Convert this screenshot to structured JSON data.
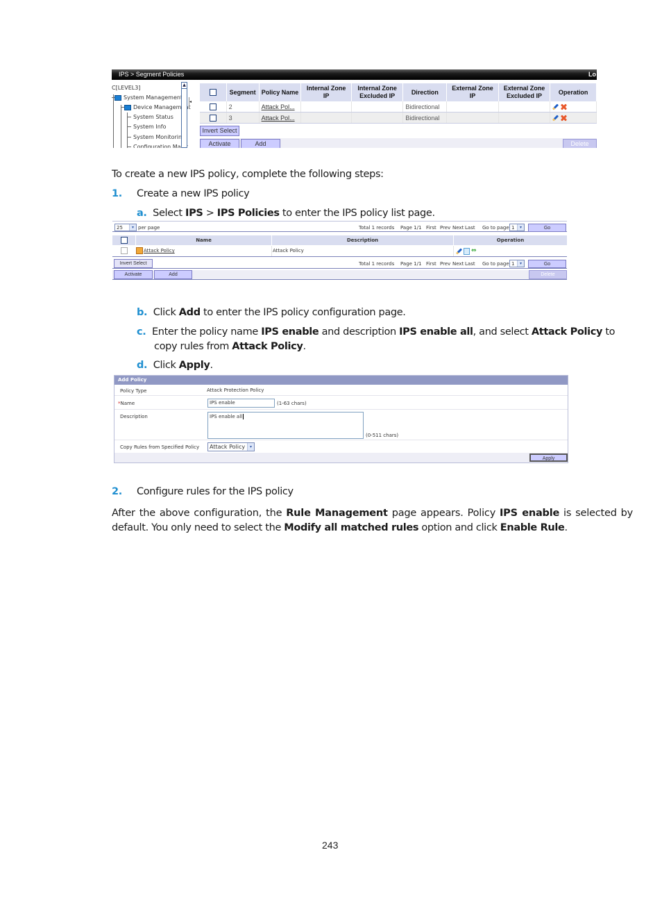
{
  "screenshot_segment_policies": {
    "breadcrumb": "IPS > Segment Policies",
    "top_right_text": "Lo",
    "tree": {
      "root": "C[LEVEL3]",
      "items": [
        {
          "label": "System Management",
          "level": 1,
          "icon": "folder-icon"
        },
        {
          "label": "Device Management",
          "level": 2,
          "icon": "folder-icon"
        },
        {
          "label": "System Status",
          "level": 3
        },
        {
          "label": "System Info",
          "level": 3
        },
        {
          "label": "System Monitoring",
          "level": 3
        },
        {
          "label": "Configuration Maint",
          "level": 3
        }
      ]
    },
    "table": {
      "columns": [
        "",
        "Segment",
        "Policy Name",
        "Internal Zone IP",
        "Internal Zone Excluded IP",
        "Direction",
        "External Zone IP",
        "External Zone Excluded IP",
        "Operation"
      ],
      "rows": [
        {
          "segment": "2",
          "policy_name": "Attack Pol...",
          "internal_zone_ip": "",
          "internal_zone_excluded_ip": "",
          "direction": "Bidirectional",
          "external_zone_ip": "",
          "external_zone_excluded_ip": "",
          "operations": [
            "edit-icon",
            "delete-icon"
          ]
        },
        {
          "segment": "3",
          "policy_name": "Attack Pol...",
          "internal_zone_ip": "",
          "internal_zone_excluded_ip": "",
          "direction": "Bidirectional",
          "external_zone_ip": "",
          "external_zone_excluded_ip": "",
          "operations": [
            "edit-icon",
            "delete-icon"
          ]
        }
      ]
    },
    "buttons": {
      "invert_select": "Invert Select",
      "activate": "Activate",
      "add": "Add",
      "delete": "Delete"
    }
  },
  "intro": "To create a new IPS policy, complete the following steps:",
  "step1": {
    "number": "1.",
    "title": "Create a new IPS policy",
    "a": {
      "letter": "a.",
      "pre": "Select ",
      "b1": "IPS",
      "mid": " > ",
      "b2": "IPS Policies",
      "post": " to enter the IPS policy list page."
    }
  },
  "screenshot_policy_list": {
    "per_page_value": "25",
    "per_page_label": "per page",
    "pagination": {
      "total": "Total 1 records",
      "page": "Page 1/1",
      "first": "First",
      "prev": "Prev",
      "next": "Next",
      "last": "Last",
      "goto_label": "Go to page",
      "goto_value": "1",
      "go": "Go"
    },
    "columns": [
      "",
      "Name",
      "Description",
      "Operation"
    ],
    "rows": [
      {
        "name": "Attack Policy",
        "description": "Attack Policy",
        "operations": [
          "edit-icon",
          "copy-icon",
          "apply-icon"
        ]
      }
    ],
    "buttons": {
      "invert_select": "Invert Select",
      "activate": "Activate",
      "add": "Add",
      "delete": "Delete"
    }
  },
  "step1_b": {
    "letter": "b.",
    "pre": "Click ",
    "b1": "Add",
    "post": " to enter the IPS policy configuration page."
  },
  "step1_c": {
    "letter": "c.",
    "line1_pre": "Enter the policy name ",
    "line1_b1": "IPS enable",
    "line1_mid": " and description ",
    "line1_b2": "IPS enable all",
    "line1_mid2": ", and select ",
    "line1_b3": "Attack Policy",
    "line1_post": " to",
    "line2_pre": "copy rules from ",
    "line2_b": "Attack Policy",
    "line2_post": "."
  },
  "step1_d": {
    "letter": "d.",
    "pre": "Click ",
    "b1": "Apply",
    "post": "."
  },
  "screenshot_add_policy": {
    "title": "Add Policy",
    "policy_type_label": "Policy Type",
    "policy_type_value": "Attack Protection Policy",
    "required_mark": "*",
    "name_label": "Name",
    "name_value": "IPS enable",
    "name_hint": "(1-63  chars)",
    "description_label": "Description",
    "description_value": "IPS enable all",
    "description_hint": "(0-511  chars)",
    "copy_rules_label": "Copy Rules from Specified Policy",
    "copy_rules_value": "Attack Policy",
    "apply": "Apply"
  },
  "step2": {
    "number": "2.",
    "title": "Configure rules for the IPS policy"
  },
  "closing": {
    "l1_pre": "After the above configuration, the ",
    "l1_b1": "Rule Management",
    "l1_mid": " page appears. Policy ",
    "l1_b2": "IPS enable",
    "l1_post": " is selected by",
    "l2_pre": "default. You only need to select the ",
    "l2_b1": "Modify all matched rules",
    "l2_mid": " option and click ",
    "l2_b2": "Enable Rule",
    "l2_post": "."
  },
  "page_number": "243"
}
